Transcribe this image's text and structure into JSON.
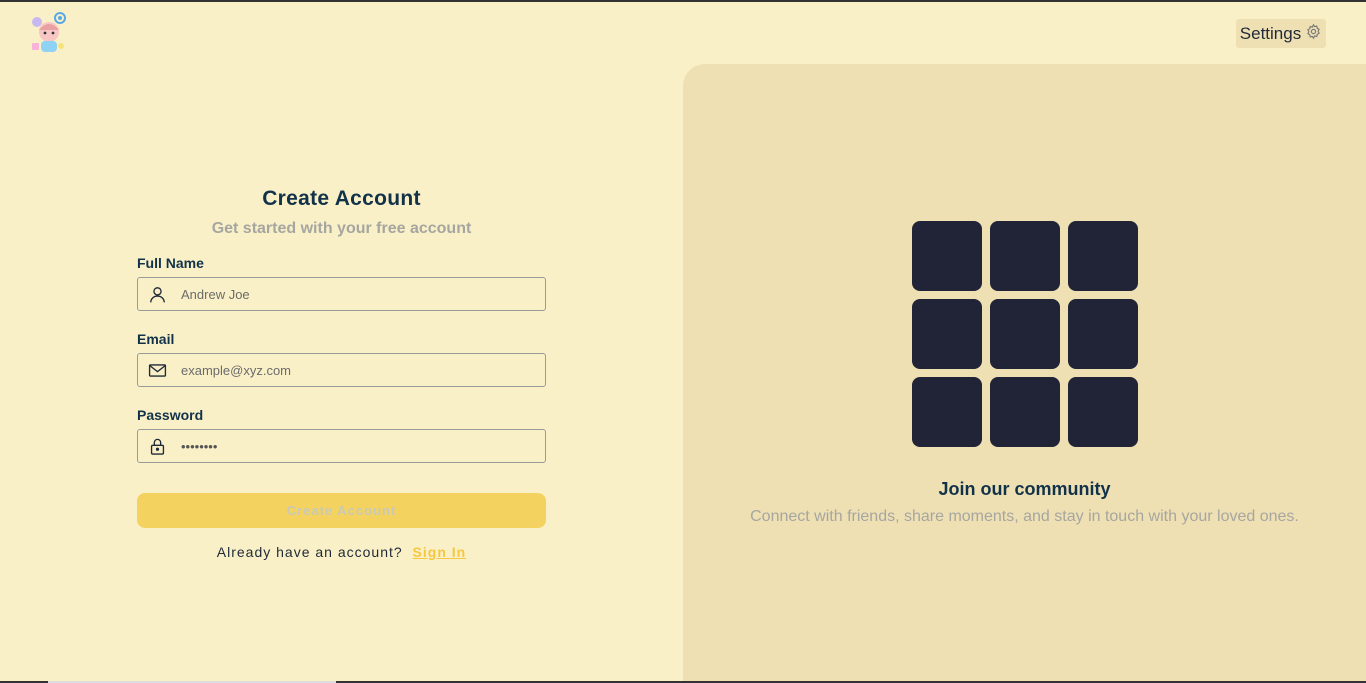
{
  "header": {
    "settings_label": "Settings"
  },
  "form": {
    "title": "Create Account",
    "subtitle": "Get started with your free account",
    "fields": [
      {
        "label": "Full Name",
        "placeholder": "Andrew Joe",
        "icon": "user-icon"
      },
      {
        "label": "Email",
        "placeholder": "example@xyz.com",
        "icon": "mail-icon"
      },
      {
        "label": "Password",
        "value": "••••••••",
        "icon": "lock-icon"
      }
    ],
    "submit_label": "Create Account",
    "signin_prompt": "Already have an account?",
    "signin_link": "Sign In"
  },
  "promo": {
    "title": "Join our community",
    "text": "Connect with friends, share moments, and stay in touch with your loved ones."
  },
  "colors": {
    "background": "#faf0c8",
    "panel": "#efe0b3",
    "accent": "#f3d25f",
    "tile": "#202436",
    "heading": "#12324a"
  }
}
